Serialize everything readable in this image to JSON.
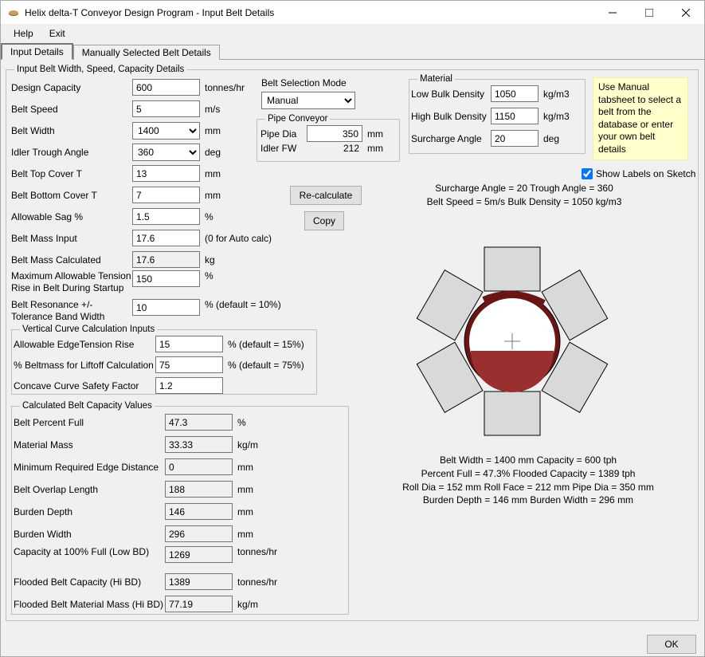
{
  "window": {
    "title": "Helix delta-T Conveyor Design Program - Input Belt Details",
    "menu": {
      "help": "Help",
      "exit": "Exit"
    },
    "tabs": {
      "input_details": "Input Details",
      "manual_belt": "Manually Selected Belt Details"
    },
    "ok": "OK"
  },
  "group_main": {
    "legend": "Input Belt Width, Speed, Capacity Details",
    "design_capacity": {
      "label": "Design Capacity",
      "value": "600",
      "unit": "tonnes/hr"
    },
    "belt_speed": {
      "label": "Belt Speed",
      "value": "5",
      "unit": "m/s"
    },
    "belt_width": {
      "label": "Belt Width",
      "value": "1400",
      "unit": "mm"
    },
    "idler_trough_angle": {
      "label": "Idler Trough Angle",
      "value": "360",
      "unit": "deg"
    },
    "belt_top_cover": {
      "label": "Belt Top Cover T",
      "value": "13",
      "unit": "mm"
    },
    "belt_bottom_cover": {
      "label": "Belt Bottom Cover T",
      "value": "7",
      "unit": "mm"
    },
    "allowable_sag": {
      "label": "Allowable Sag %",
      "value": "1.5",
      "unit": "%"
    },
    "belt_mass_input": {
      "label": "Belt Mass Input",
      "value": "17.6",
      "unit": "(0 for Auto calc)"
    },
    "belt_mass_calculated": {
      "label": "Belt Mass Calculated",
      "value": "17.6",
      "unit": "kg"
    },
    "max_tension_rise": {
      "label": "Maximum Allowable Tension Rise in Belt During Startup",
      "value": "150",
      "unit": "%"
    },
    "belt_resonance": {
      "label": "Belt Resonance +/- Tolerance Band Width",
      "value": "10",
      "unit": "% (default = 10%)"
    }
  },
  "belt_selection": {
    "label": "Belt Selection Mode",
    "value": "Manual"
  },
  "pipe": {
    "legend": "Pipe Conveyor",
    "pipe_dia": {
      "label": "Pipe Dia",
      "value": "350",
      "unit": "mm"
    },
    "idler_fw": {
      "label": "Idler FW",
      "value": "212",
      "unit": "mm"
    }
  },
  "material": {
    "legend": "Material",
    "low_bd": {
      "label": "Low Bulk Density",
      "value": "1050",
      "unit": "kg/m3"
    },
    "high_bd": {
      "label": "High Bulk Density",
      "value": "1150",
      "unit": "kg/m3"
    },
    "surcharge": {
      "label": "Surcharge Angle",
      "value": "20",
      "unit": "deg"
    }
  },
  "buttons": {
    "recalc": "Re-calculate",
    "copy": "Copy"
  },
  "manual_note": "Use Manual tabsheet to select a belt from the database or enter your own belt details",
  "show_labels": {
    "label": "Show Labels on Sketch",
    "checked": true
  },
  "sketch_top": {
    "line1": "Surcharge Angle = 20 Trough Angle = 360",
    "line2": "Belt Speed = 5m/s Bulk Density = 1050 kg/m3"
  },
  "sketch_bottom": {
    "line1": "Belt Width = 1400 mm   Capacity = 600 tph",
    "line2": "Percent Full = 47.3%  Flooded Capacity = 1389 tph",
    "line3": "Roll Dia = 152 mm   Roll Face = 212 mm Pipe Dia = 350 mm",
    "line4": "Burden Depth = 146 mm   Burden Width = 296 mm"
  },
  "vertical": {
    "legend": "Vertical Curve Calculation Inputs",
    "edge_tension": {
      "label": "Allowable EdgeTension Rise",
      "value": "15",
      "unit": "% (default = 15%)"
    },
    "beltmass_liftoff": {
      "label": "% Beltmass for Liftoff Calculation",
      "value": "75",
      "unit": "% (default = 75%)"
    },
    "concave_safety": {
      "label": "Concave Curve Safety Factor",
      "value": "1.2"
    }
  },
  "calculated": {
    "legend": "Calculated Belt Capacity Values",
    "belt_percent_full": {
      "label": "Belt Percent Full",
      "value": "47.3",
      "unit": "%"
    },
    "material_mass": {
      "label": "Material Mass",
      "value": "33.33",
      "unit": "kg/m"
    },
    "min_edge_dist": {
      "label": "Minimum Required Edge Distance",
      "value": "0",
      "unit": "mm"
    },
    "overlap_length": {
      "label": "Belt Overlap Length",
      "value": "188",
      "unit": "mm"
    },
    "burden_depth": {
      "label": "Burden Depth",
      "value": "146",
      "unit": "mm"
    },
    "burden_width": {
      "label": "Burden Width",
      "value": "296",
      "unit": "mm"
    },
    "capacity_100": {
      "label": "Capacity at 100% Full (Low BD)",
      "value": "1269",
      "unit": "tonnes/hr"
    },
    "flooded_capacity": {
      "label": "Flooded Belt Capacity (Hi BD)",
      "value": "1389",
      "unit": "tonnes/hr"
    },
    "flooded_mass": {
      "label": "Flooded Belt Material Mass (Hi BD)",
      "value": "77.19",
      "unit": "kg/m"
    }
  }
}
